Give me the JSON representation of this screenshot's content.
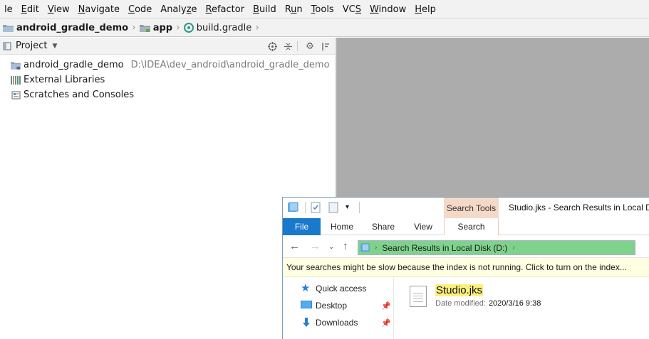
{
  "menubar": {
    "items": [
      {
        "pre": "",
        "mn": "",
        "post": "le"
      },
      {
        "pre": "",
        "mn": "E",
        "post": "dit"
      },
      {
        "pre": "",
        "mn": "V",
        "post": "iew"
      },
      {
        "pre": "",
        "mn": "N",
        "post": "avigate"
      },
      {
        "pre": "",
        "mn": "C",
        "post": "ode"
      },
      {
        "pre": "Analy",
        "mn": "z",
        "post": "e"
      },
      {
        "pre": "",
        "mn": "R",
        "post": "efactor"
      },
      {
        "pre": "",
        "mn": "B",
        "post": "uild"
      },
      {
        "pre": "R",
        "mn": "u",
        "post": "n"
      },
      {
        "pre": "",
        "mn": "T",
        "post": "ools"
      },
      {
        "pre": "VC",
        "mn": "S",
        "post": ""
      },
      {
        "pre": "",
        "mn": "W",
        "post": "indow"
      },
      {
        "pre": "",
        "mn": "H",
        "post": "elp"
      }
    ]
  },
  "breadcrumb": {
    "project": "android_gradle_demo",
    "module": "app",
    "file": "build.gradle"
  },
  "project_pane": {
    "title": "Project",
    "tree": [
      {
        "label": "android_gradle_demo",
        "path": "D:\\IDEA\\dev_android\\android_gradle_demo",
        "icon": "folder-icon"
      },
      {
        "label": "External Libraries",
        "path": "",
        "icon": "libraries-icon"
      },
      {
        "label": "Scratches and Consoles",
        "path": "",
        "icon": "scratches-icon"
      }
    ]
  },
  "explorer": {
    "context_tab": "Search Tools",
    "window_title": "Studio.jks - Search Results in Local Disk (D:)",
    "tabs": {
      "file": "File",
      "home": "Home",
      "share": "Share",
      "view": "View",
      "search": "Search"
    },
    "address": "Search Results in Local Disk (D:)",
    "info_bar": "Your searches might be slow because the index is not running.  Click to turn on the index...",
    "nav": {
      "quick_access": "Quick access",
      "desktop": "Desktop",
      "downloads": "Downloads"
    },
    "result": {
      "name": "Studio.jks",
      "date_label": "Date modified:",
      "date_value": "2020/3/16 9:38"
    }
  },
  "colors": {
    "editor_bg": "#acacac",
    "file_tab": "#1979ca",
    "search_tools_tab": "#f5d9c7",
    "address_highlight": "#7fd28c",
    "info_bar": "#ffffe1",
    "filename_highlight": "#fbf07c"
  }
}
